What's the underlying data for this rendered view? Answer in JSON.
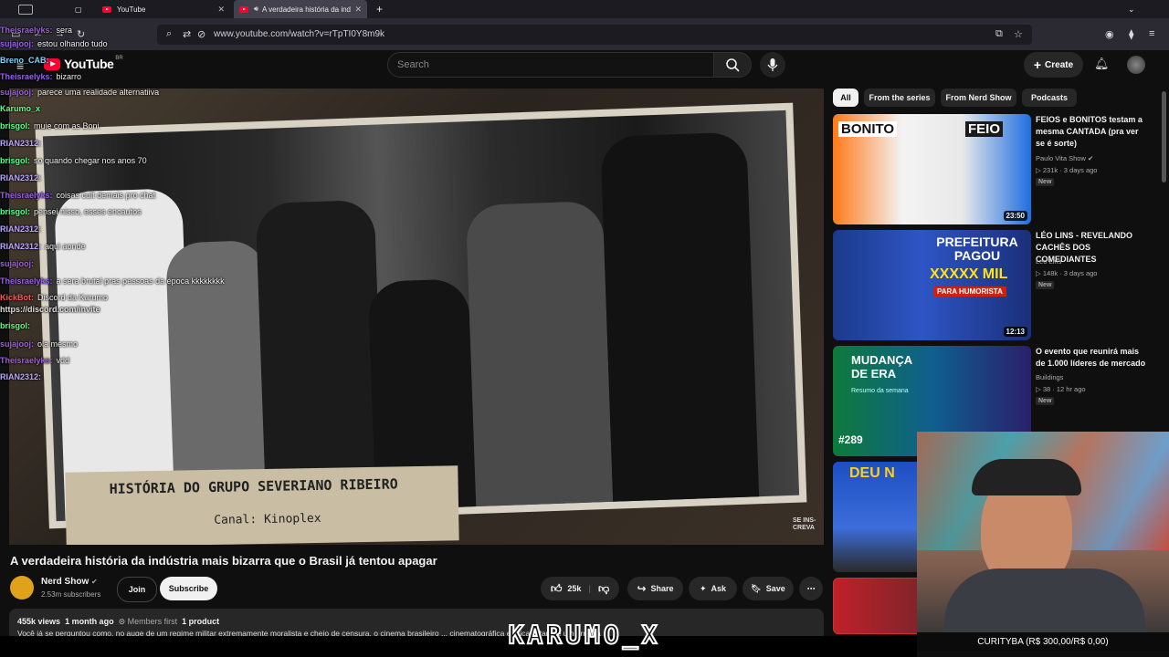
{
  "browser": {
    "tabs": [
      {
        "title": "YouTube"
      },
      {
        "title": "A verdadeira história da ind"
      }
    ],
    "url": "www.youtube.com/watch?v=rTpTI0Y8m9k"
  },
  "header": {
    "logo": "YouTube",
    "region": "BR",
    "search_placeholder": "Search",
    "create_label": "Create"
  },
  "video": {
    "caption_line1": "HISTÓRIA DO GRUPO SEVERIANO RIBEIRO",
    "caption_line2": "Canal: Kinoplex",
    "corner_mark": "SE INS- CREVA",
    "title": "A verdadeira história da indústria mais bizarra que o Brasil já tentou apagar",
    "channel": "Nerd Show",
    "subscribers": "2.53m subscribers",
    "join_label": "Join",
    "subscribe_label": "Subscribe",
    "likes": "25k",
    "share_label": "Share",
    "ask_label": "Ask",
    "save_label": "Save",
    "views": "455k views",
    "age": "1 month ago",
    "members": "Members first",
    "product": "1 product",
    "description": "Você já se perguntou como, no auge de um regime militar extremamente moralista e cheio de censura, o cinema brasileiro ... cinematográfica erótica? Parece um erro na"
  },
  "chat": [
    {
      "user": "Theisraelyks:",
      "msg": "sera",
      "color": "#9b5de5"
    },
    {
      "user": "sujajooj:",
      "msg": "estou olhando tudo",
      "color": "#9b5de5"
    },
    {
      "user": "Breno_CAB:",
      "msg": "",
      "color": "#7cd4ff"
    },
    {
      "user": "Theisraelyks:",
      "msg": "bizarro",
      "color": "#9b5de5"
    },
    {
      "user": "sujajooj:",
      "msg": "parece uma realidade alternatiiva",
      "color": "#9b5de5"
    },
    {
      "user": "Karumo_x",
      "msg": "",
      "color": "#5cff8a"
    },
    {
      "user": "brisgol:",
      "msg": "muie com as Boni",
      "color": "#5cff8a"
    },
    {
      "user": "RIAN2312:",
      "msg": "",
      "color": "#b8a6ff"
    },
    {
      "user": "brisgol:",
      "msg": "so quando chegar nos anos 70",
      "color": "#5cff8a"
    },
    {
      "user": "RIAN2312:",
      "msg": "",
      "color": "#b8a6ff"
    },
    {
      "user": "Theisraelyks:",
      "msg": "coisas cult demais pro chat",
      "color": "#9b5de5"
    },
    {
      "user": "brisgol:",
      "msg": "pensei nisso, esses encautos",
      "color": "#5cff8a"
    },
    {
      "user": "RIAN2312:",
      "msg": "",
      "color": "#b8a6ff"
    },
    {
      "user": "RIAN2312:",
      "msg": "aqui aonde",
      "color": "#b8a6ff"
    },
    {
      "user": "sujajooj:",
      "msg": "",
      "color": "#9b5de5"
    },
    {
      "user": "Theisraelyks:",
      "msg": "a sera brutal pras pessoas da época kkkkkkkk",
      "color": "#9b5de5"
    },
    {
      "user": "KickBot:",
      "msg": "Discord da Karumo",
      "color": "#ff5555"
    },
    {
      "user": "https://discord.com/invite",
      "msg": "",
      "color": "#dddddd"
    },
    {
      "user": "brisgol:",
      "msg": "",
      "color": "#5cff8a"
    },
    {
      "user": "sujajooj:",
      "msg": "ola mesmo",
      "color": "#9b5de5"
    },
    {
      "user": "Theisraelyks:",
      "msg": "vdd",
      "color": "#9b5de5"
    },
    {
      "user": "RIAN2312:",
      "msg": "",
      "color": "#b8a6ff"
    }
  ],
  "sidebar": {
    "chips": [
      "All",
      "From the series",
      "From Nerd Show",
      "Podcasts"
    ],
    "recs": [
      {
        "title": "FEIOS e BONITOS testam a mesma CANTADA (pra ver se é sorte)",
        "channel": "Paulo Vita Show",
        "meta": "231k · 3 days ago",
        "badge": "New",
        "duration": "23:50",
        "thumb_text1": "BONITO",
        "thumb_text2": "FEIO"
      },
      {
        "title": "LÉO LINS - REVELANDO CACHÊS DOS COMEDIANTES",
        "channel": "Léo Lins",
        "meta": "148k · 3 days ago",
        "badge": "New",
        "duration": "12:13",
        "thumb_text1": "PREFEITURA PAGOU",
        "thumb_text2": "XXXXX MIL",
        "thumb_text3": "PARA HUMORISTA"
      },
      {
        "title": "O evento que reunirá mais de 1.000 líderes de mercado",
        "channel": "Buildings",
        "meta": "38 · 12 hr ago",
        "badge": "New",
        "duration": "",
        "thumb_text1": "MUDANÇA DE ERA",
        "thumb_text2": "Resumo da semana",
        "thumb_text3": "#289"
      },
      {
        "title": "",
        "channel": "",
        "meta": "",
        "badge": "",
        "duration": "",
        "thumb_text1": "DEU N"
      }
    ]
  },
  "overlay": {
    "cam_label": "CURITYBA (R$ 300,00/R$ 0,00)",
    "brand": "KARUMO_X"
  },
  "colors": {
    "accent": "#ff0033",
    "bg": "#0f0f0f",
    "chip": "#272727"
  }
}
